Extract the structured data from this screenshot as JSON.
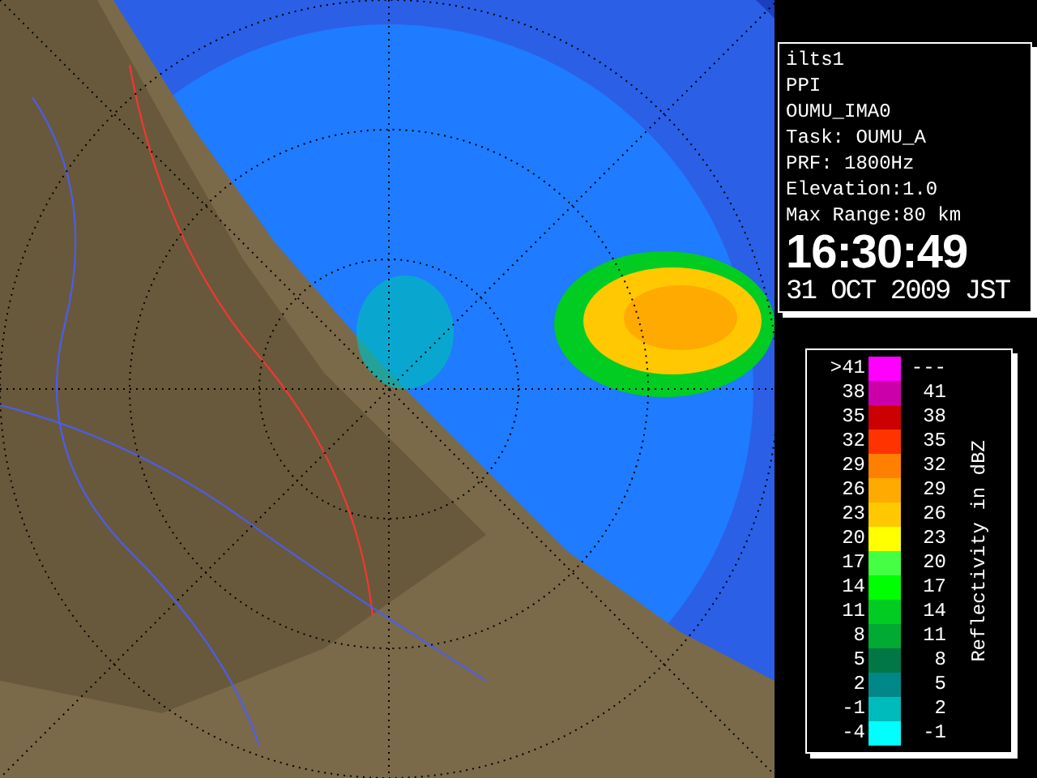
{
  "info_panel": {
    "lines": [
      "ilts1",
      "PPI",
      "OUMU_IMA0",
      "Task: OUMU_A",
      "PRF: 1800Hz",
      "Elevation:1.0",
      "Max Range:80 km"
    ],
    "time": "16:30:49",
    "date": "31 OCT 2009 JST"
  },
  "legend": {
    "title": "Reflectivity in dBZ",
    "rows": [
      {
        "low": ">41",
        "high": "---",
        "color": "#ff00ff"
      },
      {
        "low": "38",
        "high": "41",
        "color": "#cc00aa"
      },
      {
        "low": "35",
        "high": "38",
        "color": "#cc0000"
      },
      {
        "low": "32",
        "high": "35",
        "color": "#ff3300"
      },
      {
        "low": "29",
        "high": "32",
        "color": "#ff8000"
      },
      {
        "low": "26",
        "high": "29",
        "color": "#ffaa00"
      },
      {
        "low": "23",
        "high": "26",
        "color": "#ffc800"
      },
      {
        "low": "20",
        "high": "23",
        "color": "#ffff00"
      },
      {
        "low": "17",
        "high": "20",
        "color": "#44ff44"
      },
      {
        "low": "14",
        "high": "17",
        "color": "#00ff00"
      },
      {
        "low": "11",
        "high": "14",
        "color": "#00cc22"
      },
      {
        "low": "8",
        "high": "11",
        "color": "#00aa33"
      },
      {
        "low": "5",
        "high": "8",
        "color": "#007744"
      },
      {
        "low": "2",
        "high": "5",
        "color": "#008888"
      },
      {
        "low": "-1",
        "high": "2",
        "color": "#00bbbb"
      },
      {
        "low": "-4",
        "high": "-1",
        "color": "#00ffff"
      }
    ]
  }
}
